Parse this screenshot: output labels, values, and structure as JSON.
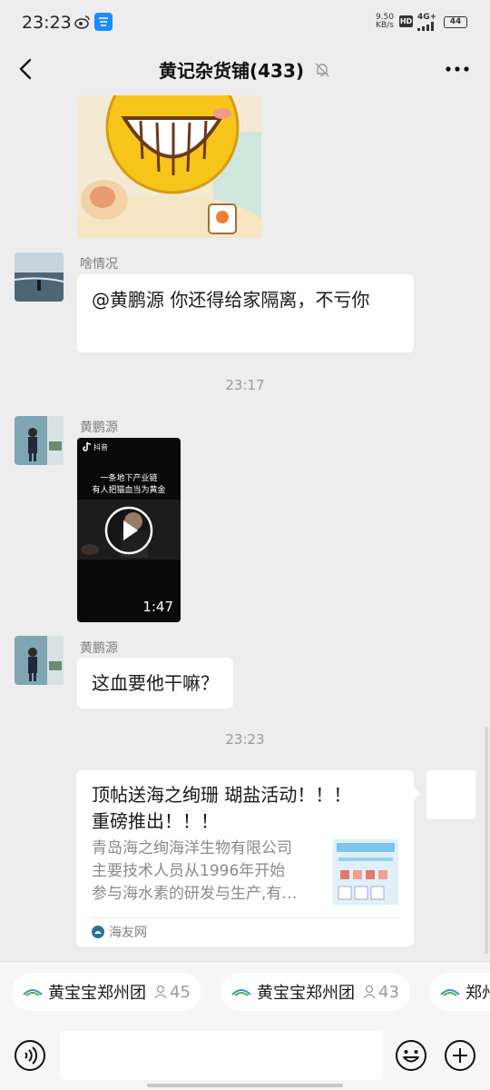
{
  "status_bar": {
    "time": "23:23",
    "net_speed_value": "9.50",
    "net_speed_unit": "KB/s",
    "hd_badge": "HD",
    "network": "4G+",
    "battery": "44"
  },
  "header": {
    "title": "黄记杂货铺(433)"
  },
  "messages": [
    {
      "type": "image",
      "alt": "sticker"
    },
    {
      "type": "text",
      "sender": "啥情况",
      "text": "@黄鹏源  你还得给家隔离，不亏你"
    },
    {
      "type": "time",
      "text": "23:17"
    },
    {
      "type": "video",
      "sender": "黄鹏源",
      "app_name": "抖音",
      "caption_line1": "一条地下产业链",
      "caption_line2": "有人把猫血当为黄金",
      "duration": "1:47"
    },
    {
      "type": "text",
      "sender": "黄鹏源",
      "text": "这血要他干嘛？"
    },
    {
      "type": "time",
      "text": "23:23"
    },
    {
      "type": "link",
      "title_line1": "顶帖送海之绚珊 瑚盐活动！！！",
      "title_line2": "重磅推出！！！",
      "desc_line1": "青岛海之绚海洋生物有限公司",
      "desc_line2": "主要技术人员从1996年开始",
      "desc_line3": "参与海水素的研发与生产,有…",
      "source": "海友网"
    }
  ],
  "chips": [
    {
      "label": "黄宝宝郑州团",
      "count": "45"
    },
    {
      "label": "黄宝宝郑州团",
      "count": "43"
    },
    {
      "label": "郑州",
      "count": ""
    }
  ],
  "input": {
    "placeholder": ""
  },
  "colors": {
    "background": "#ededed",
    "bubble": "#ffffff",
    "secondary_text": "#7f7f7f",
    "chip_icon_blue": "#3a8fd6",
    "chip_icon_green": "#4caf50"
  }
}
